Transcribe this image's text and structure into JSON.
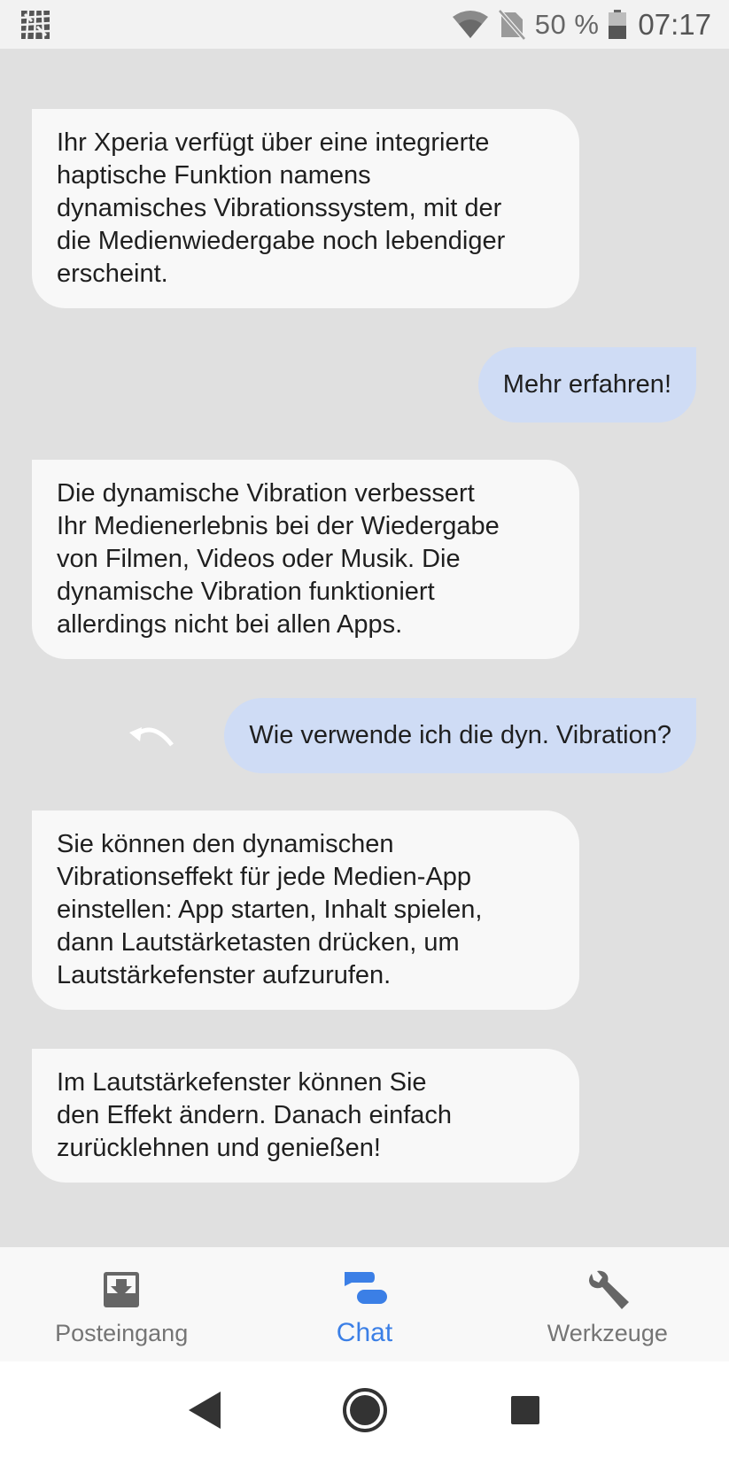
{
  "status_bar": {
    "battery_text": "50 %",
    "time": "07:17",
    "icons": [
      "app-icon",
      "wifi-icon",
      "no-sim-icon",
      "battery-icon"
    ]
  },
  "chat": {
    "messages": [
      {
        "from": "bot",
        "text": "Ihr Xperia verfügt über eine integrierte\nhaptische Funktion namens\ndynamisches Vibrationssystem, mit der\ndie Medienwiedergabe noch lebendiger\nerscheint."
      },
      {
        "from": "user",
        "text": "Mehr erfahren!"
      },
      {
        "from": "bot",
        "text": "Die dynamische Vibration verbessert\nIhr Medienerlebnis bei der Wiedergabe\nvon Filmen, Videos oder Musik. Die\ndynamische Vibration funktioniert\nallerdings nicht bei allen Apps."
      },
      {
        "from": "user",
        "text": "Wie verwende ich die dyn. Vibration?"
      },
      {
        "from": "bot",
        "text": "Sie können den dynamischen\nVibrationseffekt für jede Medien-App\neinstellen: App starten, Inhalt spielen,\ndann Lautstärketasten drücken, um\nLautstärkefenster aufzurufen."
      },
      {
        "from": "bot",
        "text": "Im Lautstärkefenster können Sie\nden Effekt ändern. Danach einfach\nzurücklehnen und genießen!"
      }
    ]
  },
  "tabs": [
    {
      "label": "Posteingang",
      "icon": "inbox-icon",
      "active": false
    },
    {
      "label": "Chat",
      "icon": "chat-icon",
      "active": true
    },
    {
      "label": "Werkzeuge",
      "icon": "wrench-icon",
      "active": false
    }
  ],
  "colors": {
    "accent": "#3b7fe6",
    "user_bubble": "#cfdcf5",
    "bot_bubble": "#f8f8f8",
    "background": "#e0e0e0"
  },
  "navbar": {
    "buttons": [
      "back-icon",
      "home-icon",
      "recents-icon"
    ]
  }
}
